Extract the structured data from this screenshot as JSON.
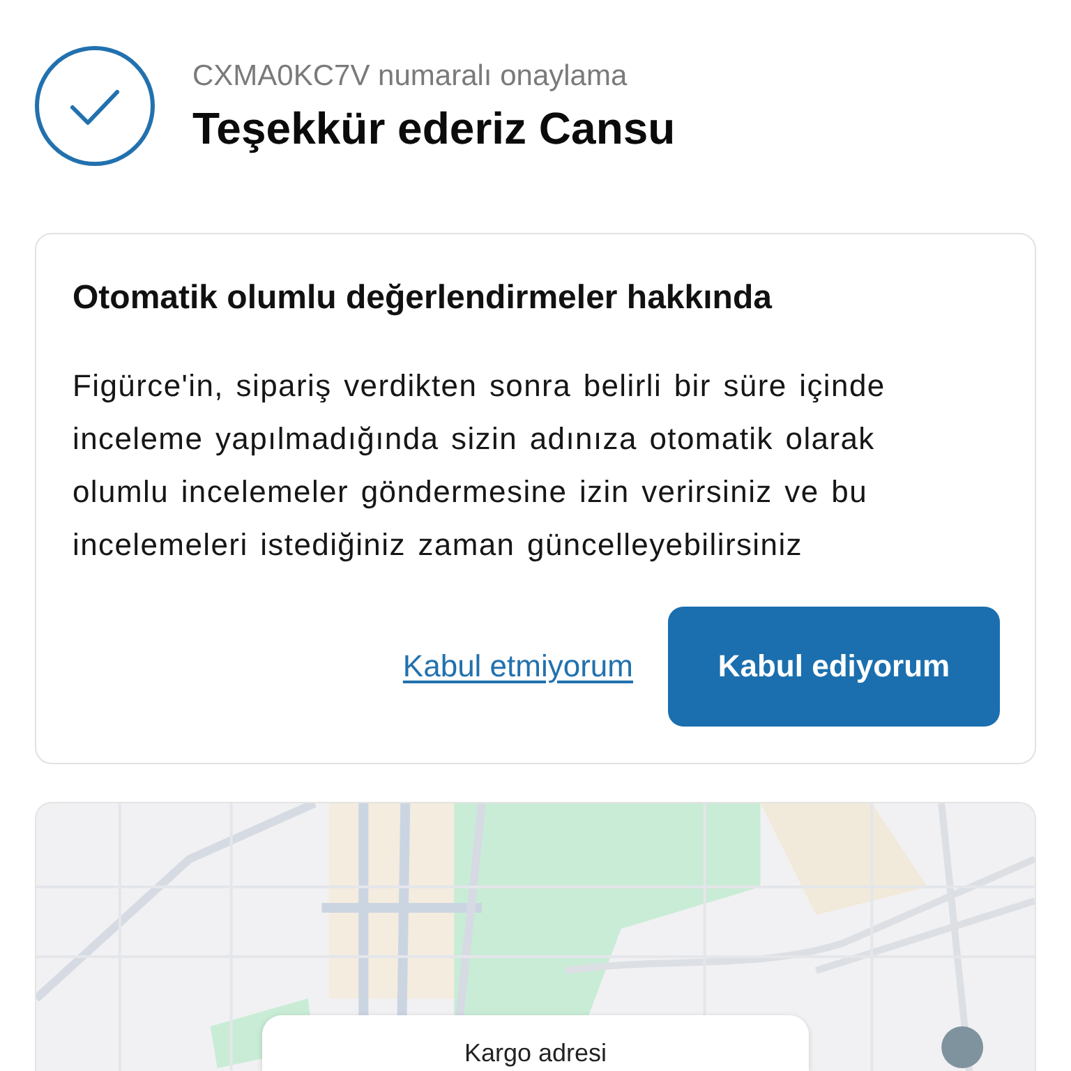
{
  "header": {
    "subtitle": "CXMA0KC7V numaralı onaylama",
    "title": "Teşekkür ederiz Cansu"
  },
  "consent_card": {
    "title": "Otomatik olumlu değerlendirmeler hakkında",
    "body": "Figürce'in, sipariş verdikten sonra belirli bir süre içinde inceleme yapılmadığında sizin adınıza otomatik olarak olumlu incelemeler göndermesine izin verirsiniz ve bu incelemeleri istediğiniz zaman güncelleyebilirsiniz",
    "decline_link": "Kabul etmiyorum",
    "accept_button": "Kabul ediyorum"
  },
  "map": {
    "address_card": {
      "title": "Kargo adresi"
    }
  }
}
